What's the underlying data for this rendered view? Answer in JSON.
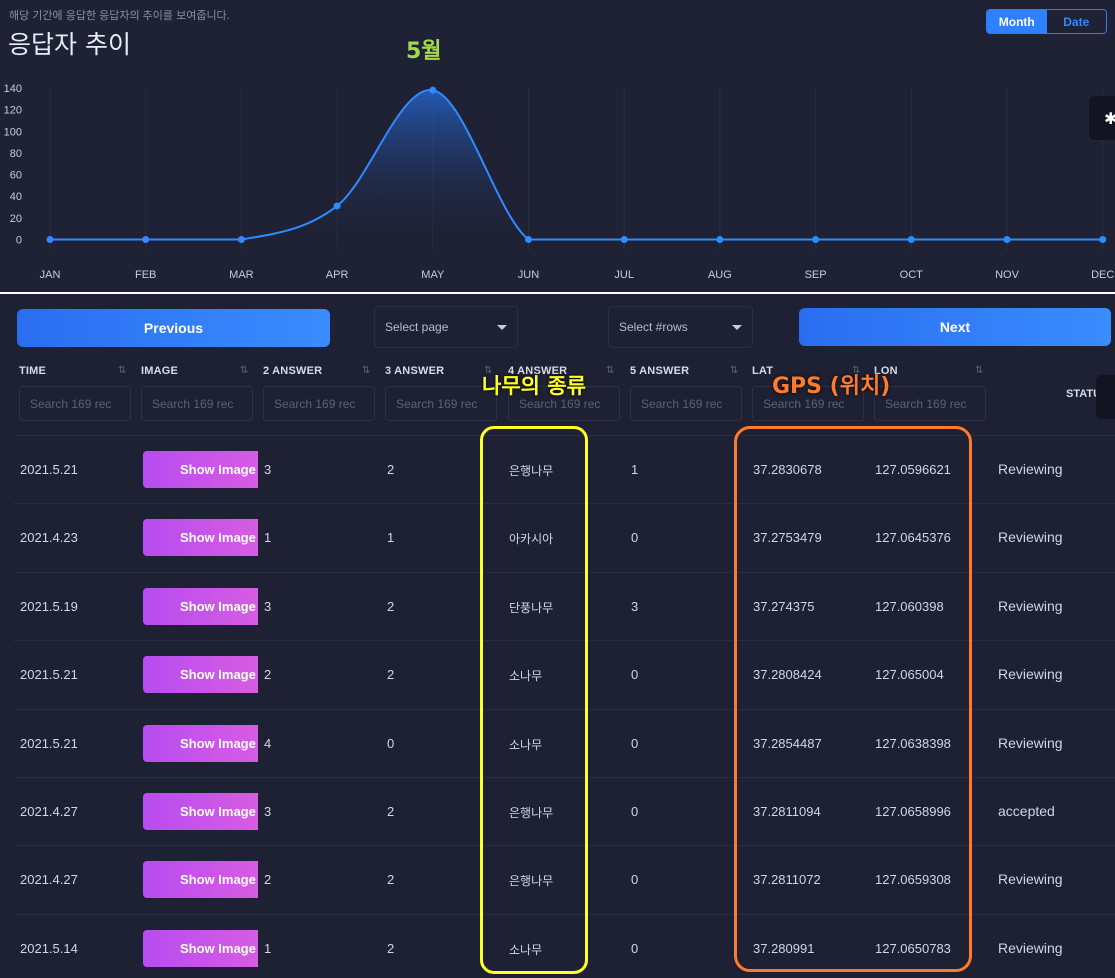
{
  "chart_panel": {
    "subtitle": "해당 기간에 응답한 응답자의 추이를 보여줍니다.",
    "title": "응답자 추이",
    "toggle": {
      "month": "Month",
      "date": "Date",
      "active": "Month"
    },
    "annotation": "5월"
  },
  "chart_data": {
    "type": "area",
    "categories": [
      "JAN",
      "FEB",
      "MAR",
      "APR",
      "MAY",
      "JUN",
      "JUL",
      "AUG",
      "SEP",
      "OCT",
      "NOV",
      "DEC"
    ],
    "series": [
      {
        "values": [
          0,
          0,
          0,
          31,
          138,
          0,
          0,
          0,
          0,
          0,
          0,
          0
        ]
      }
    ],
    "yticks": [
      0,
      20,
      40,
      60,
      80,
      100,
      120,
      140
    ],
    "ylim": [
      0,
      140
    ],
    "grid": "vertical",
    "colors": {
      "line": "#2f8bff",
      "fill_top": "#2563c9",
      "fill_bottom": "#1f2235"
    }
  },
  "controls": {
    "previous": "Previous",
    "next": "Next",
    "select_page": "Select page",
    "select_rows": "Select #rows"
  },
  "columns": [
    {
      "key": "time",
      "label": "TIME"
    },
    {
      "key": "image",
      "label": "IMAGE"
    },
    {
      "key": "a2",
      "label": "2 ANSWER"
    },
    {
      "key": "a3",
      "label": "3 ANSWER"
    },
    {
      "key": "a4",
      "label": "4 ANSWER"
    },
    {
      "key": "a5",
      "label": "5 ANSWER"
    },
    {
      "key": "lat",
      "label": "LAT"
    },
    {
      "key": "lon",
      "label": "LON"
    },
    {
      "key": "status",
      "label": "STATUS"
    }
  ],
  "filter_placeholder": "Search 169 rec",
  "image_button_label": "Show Image",
  "rows": [
    {
      "time": "2021.5.21",
      "a2": "3",
      "a3": "2",
      "a4": "은행나무",
      "a5": "1",
      "lat": "37.2830678",
      "lon": "127.0596621",
      "status": "Reviewing"
    },
    {
      "time": "2021.4.23",
      "a2": "1",
      "a3": "1",
      "a4": "아카시아",
      "a5": "0",
      "lat": "37.2753479",
      "lon": "127.0645376",
      "status": "Reviewing"
    },
    {
      "time": "2021.5.19",
      "a2": "3",
      "a3": "2",
      "a4": "단풍나무",
      "a5": "3",
      "lat": "37.274375",
      "lon": "127.060398",
      "status": "Reviewing"
    },
    {
      "time": "2021.5.21",
      "a2": "2",
      "a3": "2",
      "a4": "소나무",
      "a5": "0",
      "lat": "37.2808424",
      "lon": "127.065004",
      "status": "Reviewing"
    },
    {
      "time": "2021.5.21",
      "a2": "4",
      "a3": "0",
      "a4": "소나무",
      "a5": "0",
      "lat": "37.2854487",
      "lon": "127.0638398",
      "status": "Reviewing"
    },
    {
      "time": "2021.4.27",
      "a2": "3",
      "a3": "2",
      "a4": "은행나무",
      "a5": "0",
      "lat": "37.2811094",
      "lon": "127.0658996",
      "status": "accepted"
    },
    {
      "time": "2021.4.27",
      "a2": "2",
      "a3": "2",
      "a4": "은행나무",
      "a5": "0",
      "lat": "37.2811072",
      "lon": "127.0659308",
      "status": "Reviewing"
    },
    {
      "time": "2021.5.14",
      "a2": "1",
      "a3": "2",
      "a4": "소나무",
      "a5": "0",
      "lat": "37.280991",
      "lon": "127.0650783",
      "status": "Reviewing"
    }
  ],
  "highlights": {
    "tree_label": "나무의 종류",
    "gps_label": "GPS (위치)",
    "yellow": "#ffff2a",
    "orange": "#ff7a2c"
  }
}
